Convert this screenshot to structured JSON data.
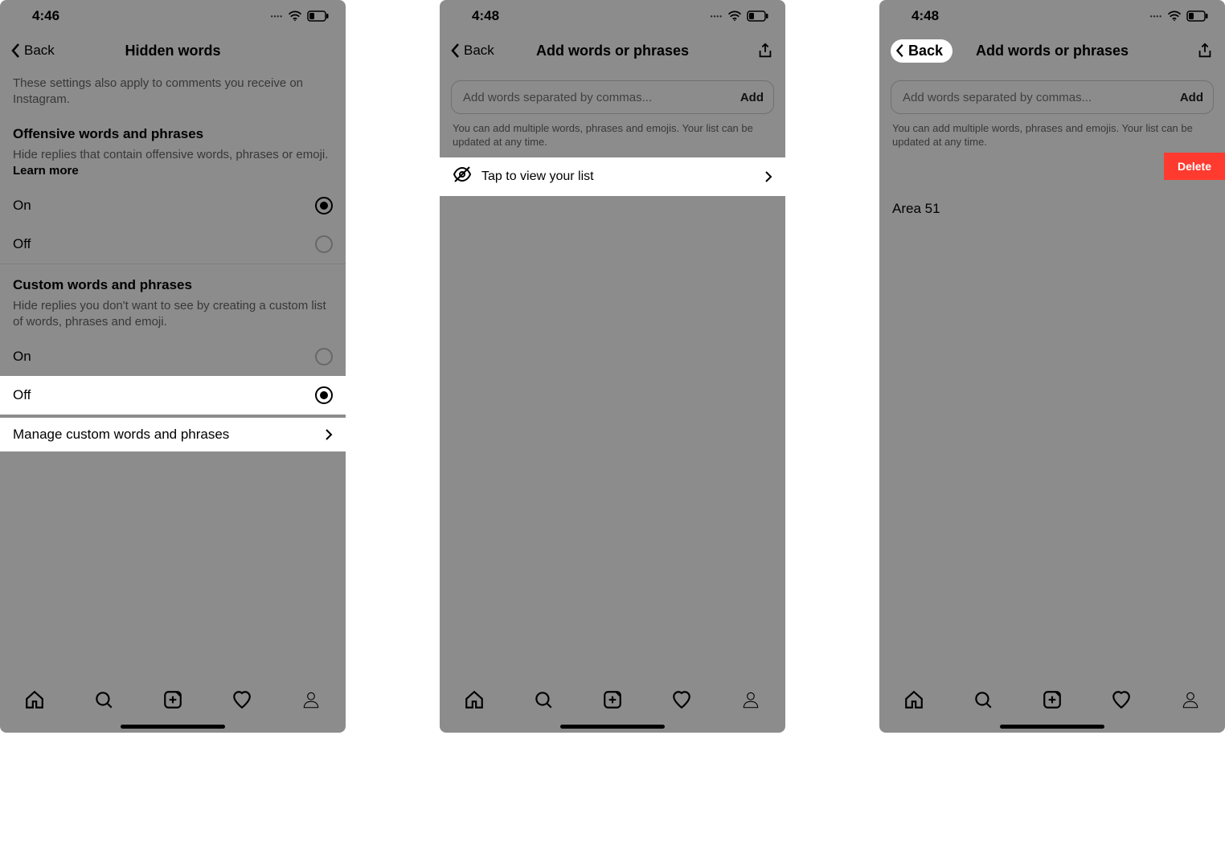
{
  "colors": {
    "delete_bg": "#ff3b30"
  },
  "screen1": {
    "time": "4:46",
    "back": "Back",
    "title": "Hidden words",
    "intro": "These settings also apply to comments you receive on Instagram.",
    "offensive": {
      "title": "Offensive words and phrases",
      "desc": "Hide replies that contain offensive words, phrases or emoji. ",
      "learn": "Learn more",
      "on": "On",
      "off": "Off",
      "selected": "on"
    },
    "custom": {
      "title": "Custom words and phrases",
      "desc": "Hide replies you don't want to see by creating a custom list of words, phrases and emoji.",
      "on": "On",
      "off": "Off",
      "selected": "off",
      "manage": "Manage custom words and phrases"
    }
  },
  "screen2": {
    "time": "4:48",
    "back": "Back",
    "title": "Add words or phrases",
    "placeholder": "Add words separated by commas...",
    "add": "Add",
    "helper": "You can add multiple words, phrases and emojis. Your list can be updated at any time.",
    "tap": "Tap to view your list"
  },
  "screen3": {
    "time": "4:48",
    "back": "Back",
    "title": "Add words or phrases",
    "placeholder": "Add words separated by commas...",
    "add": "Add",
    "helper": "You can add multiple words, phrases and emojis. Your list can be updated at any time.",
    "delete": "Delete",
    "word": "Area 51"
  }
}
